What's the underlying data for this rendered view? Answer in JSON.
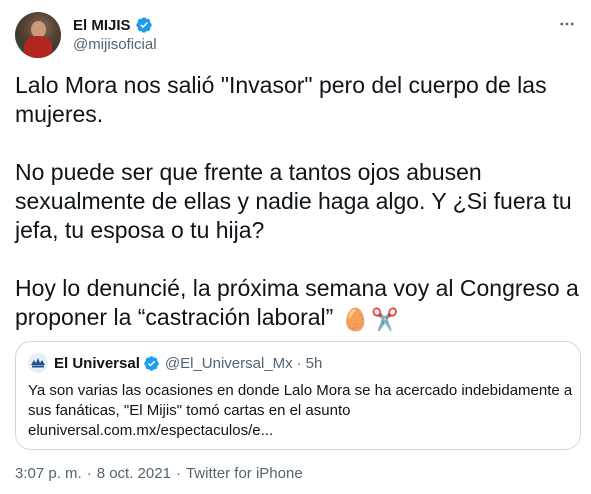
{
  "author": {
    "display_name": "El MIJIS",
    "handle": "@mijisoficial"
  },
  "tweet": {
    "paragraphs": [
      "Lalo Mora nos salió \"Invasor\" pero del cuerpo de las mujeres.",
      "No puede ser que frente a tantos ojos abusen sexualmente de ellas y nadie haga algo. Y ¿Si fuera tu jefa, tu esposa o tu hija?",
      "Hoy lo denuncié, la próxima semana voy al Congreso a proponer la “castración laboral”"
    ],
    "emojis": [
      "🥚",
      "✂️"
    ]
  },
  "quote": {
    "display_name": "El Universal",
    "handle": "@El_Universal_Mx",
    "separator": "·",
    "time": "5h",
    "text": "Ya son varias las ocasiones en donde Lalo Mora se ha acercado indebidamente a sus fanáticas, \"El Mijis\" tomó cartas en el asunto",
    "link": "eluniversal.com.mx/espectaculos/e..."
  },
  "meta": {
    "time": "3:07 p. m.",
    "separator": "·",
    "date": "8 oct. 2021",
    "source": "Twitter for iPhone"
  },
  "colors": {
    "verified": "#1d9bf0",
    "secondary_text": "#536471",
    "border": "#cfd9de"
  },
  "icons": {
    "verified": "verified-badge-icon",
    "more": "more-horizontal-icon",
    "quote_avatar": "el-universal-logo-icon"
  }
}
